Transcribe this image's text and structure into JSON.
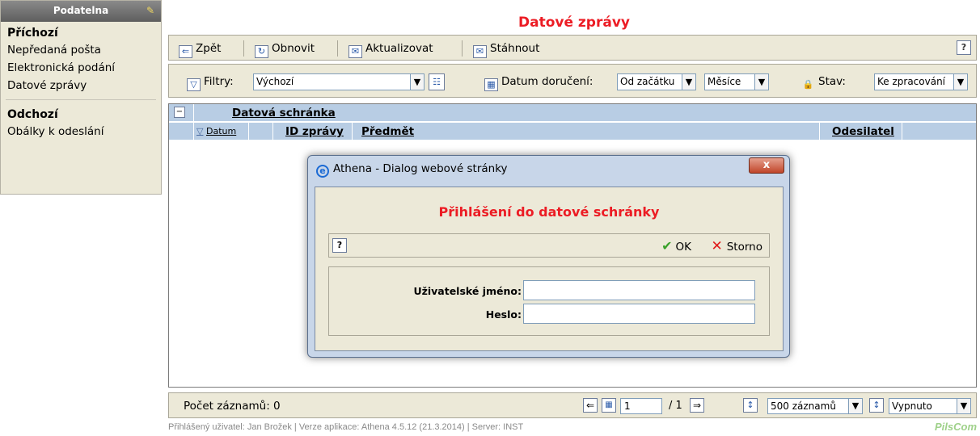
{
  "sidebar": {
    "header": "Podatelna",
    "incoming_title": "Příchozí",
    "incoming_items": [
      "Nepředaná pošta",
      "Elektronická podání",
      "Datové zprávy"
    ],
    "outgoing_title": "Odchozí",
    "outgoing_items": [
      "Obálky k odeslání"
    ]
  },
  "page_title": "Datové zprávy",
  "toolbar": {
    "back_label": "Zpět",
    "refresh_label": "Obnovit",
    "update_label": "Aktualizovat",
    "download_label": "Stáhnout",
    "help_label": "?"
  },
  "filters": {
    "filters_label": "Filtry:",
    "filter_value": "Výchozí",
    "delivery_date_label": "Datum doručení:",
    "date_from_value": "Od začátku",
    "date_unit_value": "Měsíce",
    "state_label": "Stav:",
    "state_value": "Ke zpracování"
  },
  "grid": {
    "group_header": "Datová schránka",
    "columns": {
      "date": "Datum",
      "message_id": "ID zprávy",
      "subject": "Předmět",
      "sender": "Odesilatel"
    }
  },
  "footer": {
    "record_count_label": "Počet záznamů: 0",
    "page_value": "1",
    "page_total": "/ 1",
    "page_size_value": "500 záznamů",
    "off_value": "Vypnuto"
  },
  "status_bar": "Přihlášený uživatel: Jan Brožek  |  Verze aplikace: Athena 4.5.12 (21.3.2014)  |  Server: INST",
  "brand": "PilsCom",
  "dialog": {
    "window_title": "Athena - Dialog webové stránky",
    "close_label": "x",
    "heading": "Přihlášení do datové schránky",
    "help_label": "?",
    "ok_label": "OK",
    "cancel_label": "Storno",
    "username_label": "Uživatelské jméno:",
    "password_label": "Heslo:",
    "username_value": "",
    "password_value": ""
  },
  "colors": {
    "title_red": "#ec1c24",
    "panel_beige": "#ece9d8",
    "grid_header_blue": "#b8cde4",
    "ok_green": "#3aa12a",
    "storno_red": "#e01b1b"
  }
}
